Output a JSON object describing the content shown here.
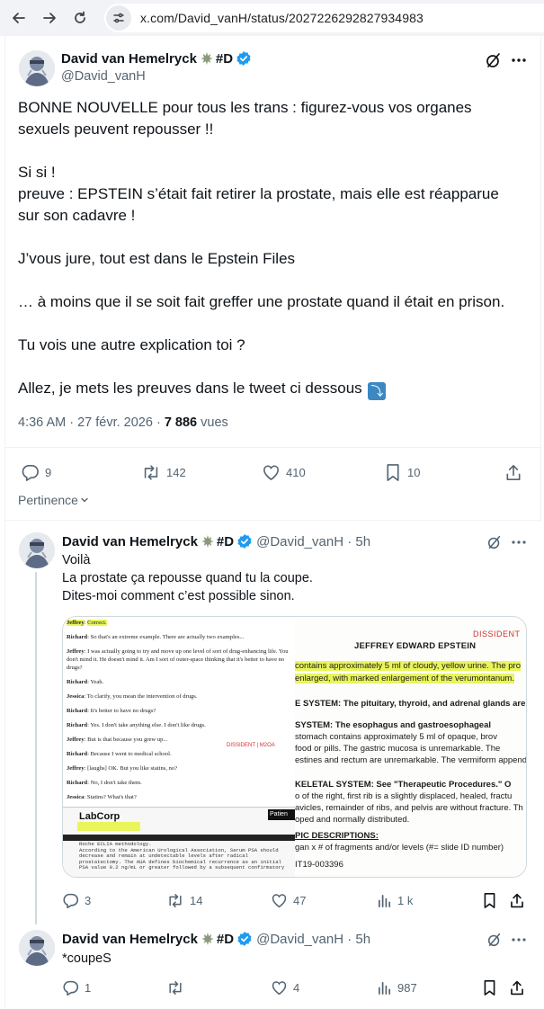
{
  "browser": {
    "url": "x.com/David_vanH/status/2027226292827934983"
  },
  "main_tweet": {
    "author_name": "David van Hemelryck",
    "author_suffix": "#D",
    "handle": "@David_vanH",
    "paragraphs": [
      "BONNE NOUVELLE pour tous les trans : figurez-vous vos organes sexuels peuvent repousser !!",
      "Si si !\npreuve : EPSTEIN s’était fait retirer la prostate, mais elle est réapparue sur son cadavre !",
      "J’vous jure, tout est dans le Epstein Files",
      "… à moins que il se soit fait greffer une prostate quand il était en prison.",
      "Tu vois une autre explication toi ?",
      "Allez, je mets les preuves dans le tweet ci dessous"
    ],
    "timestamp": "4:36 AM · 27 févr. 2026 · ",
    "views_count": "7 886",
    "views_label": " vues",
    "replies": "9",
    "reposts": "142",
    "likes": "410",
    "bookmarks": "10",
    "relevance_label": "Pertinence"
  },
  "reply1": {
    "author_name": "David van Hemelryck",
    "author_suffix": "#D",
    "handle_time": "@David_vanH · 5h",
    "text": "Voilà\nLa prostate ça repousse quand tu la coupe.\nDites-moi comment c’est possible sinon.",
    "replies": "3",
    "reposts": "14",
    "likes": "47",
    "views": "1 k",
    "media": {
      "left_lines": [
        {
          "who": "Jeffrey",
          "text": "Correct.",
          "hl": true
        },
        {
          "who": "Richard",
          "text": "So that's an extreme example. There are actually two examples...",
          "hl": false
        },
        {
          "who": "Jeffrey",
          "text": "I was actually going to try and move up one level of sort of drug-enhancing life. You don't mind it. He doesn't mind it. Am I sort of outer-space thinking that it's better to have no drugs?",
          "hl": false
        },
        {
          "who": "Richard",
          "text": "Yeah.",
          "hl": false
        },
        {
          "who": "Jessica",
          "text": "To clarify, you mean the intervention of drugs.",
          "hl": false
        },
        {
          "who": "Richard",
          "text": "It's better to have no drugs?",
          "hl": false
        },
        {
          "who": "Richard",
          "text": "Yes. I don't take anything else. I don't like drugs.",
          "hl": false
        },
        {
          "who": "Jeffrey",
          "text": "But is that because you grew up...",
          "hl": false
        },
        {
          "who": "Richard",
          "text": "Because I went to medical school.",
          "hl": false
        },
        {
          "who": "Jeffrey",
          "text": "[laughs] OK. But you like statins, no?",
          "hl": false
        },
        {
          "who": "Richard",
          "text": "No, I don't take them.",
          "hl": false
        },
        {
          "who": "Jessica",
          "text": "Statins? What's that?",
          "hl": false
        },
        {
          "who": "Jeffrey",
          "text": "They reduce your cholesterol. You don't take any of those things?",
          "hl": false
        }
      ],
      "left_stamp": "DISSIDENT | M2OA",
      "labcorp_logo": "LabCorp",
      "labcorp_patient": "Patien",
      "labcorp_text": "Roche ECLIA methodology.\nAccording to the American Urological Association, Serum PSA should decrease and remain at undetectable levels after radical prostatectomy. The AUA defines biochemical recurrence as an initial PSA value 0.2 ng/mL or greater followed by a subsequent confirmatory",
      "right_stamp": "DISSIDENT",
      "right_title": "JEFFREY EDWARD EPSTEIN",
      "right_lines": [
        "contains approximately 5 ml of cloudy, yellow urine.  The pro",
        "enlarged, with marked enlargement of the verumontanum.",
        "E SYSTEM:  The pituitary, thyroid, and adrenal glands are un",
        " SYSTEM:     The esophagus and gastroesophageal",
        " food or pills.  The gastric mucosa is unremarkable.  The",
        "estines and rectum are unremarkable.  The vermiform append",
        "KELETAL SYSTEM:  See \"Therapeutic Procedures.\"  O",
        "o of the right, first rib is a slightly displaced, healed, fractu",
        "avicles, remainder of ribs, and pelvis are without fracture.  Th",
        "oped and normally distributed.",
        "PIC DESCRIPTIONS:",
        "gan x # of fragments and/or levels      (#= slide ID number)",
        "IT19-003396",
        " stomach contains approximately 5 ml of opaque, brov"
      ]
    }
  },
  "reply2": {
    "author_name": "David van Hemelryck",
    "author_suffix": "#D",
    "handle_time": "@David_vanH · 5h",
    "text": "*coupeS",
    "replies": "1",
    "reposts": "",
    "likes": "4",
    "views": "987"
  },
  "icons": {
    "verified_color": "#1d9bf0",
    "accent": "#1d9bf0",
    "muted": "#536471",
    "highlight": "#e9f55a"
  }
}
